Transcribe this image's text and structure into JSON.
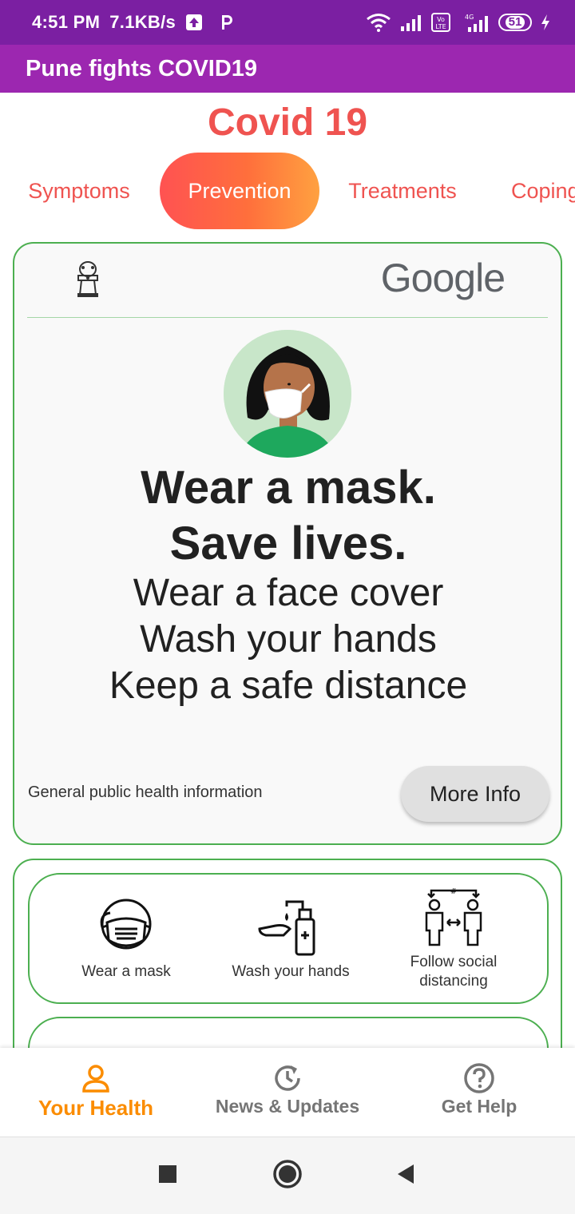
{
  "status_bar": {
    "time": "4:51 PM",
    "speed": "7.1KB/s",
    "battery": "51",
    "icons": [
      "upload-arrow-icon",
      "p-app-icon",
      "wifi-icon",
      "signal-icon",
      "volte-icon",
      "4g-signal-icon",
      "battery-icon",
      "charging-icon"
    ]
  },
  "app_bar": {
    "title": "Pune fights COVID19"
  },
  "header": {
    "title": "Covid 19",
    "tabs": [
      {
        "label": "Symptoms"
      },
      {
        "label": "Prevention",
        "active": true
      },
      {
        "label": "Treatments"
      },
      {
        "label": "Coping"
      }
    ]
  },
  "card": {
    "logo_text": "Google",
    "headline_1": "Wear a mask.",
    "headline_2": "Save lives.",
    "tips": [
      "Wear a face cover",
      "Wash your hands",
      "Keep a safe distance"
    ],
    "info_text": "General public health information",
    "button_label": "More Info"
  },
  "prevention": {
    "items": [
      {
        "label": "Wear a mask",
        "icon": "mask-icon"
      },
      {
        "label": "Wash your hands",
        "icon": "hand-wash-icon"
      },
      {
        "label": "Follow social distancing",
        "icon": "social-distancing-icon"
      }
    ]
  },
  "bottom_nav": {
    "items": [
      {
        "label": "Your Health",
        "icon": "person-icon",
        "active": true
      },
      {
        "label": "News & Updates",
        "icon": "history-icon"
      },
      {
        "label": "Get Help",
        "icon": "help-icon"
      }
    ]
  },
  "colors": {
    "status_bar": "#7b1fa2",
    "app_bar": "#9c27b0",
    "accent_red": "#ef5350",
    "accent_orange": "#fb8c00",
    "card_border": "#4caf50"
  }
}
